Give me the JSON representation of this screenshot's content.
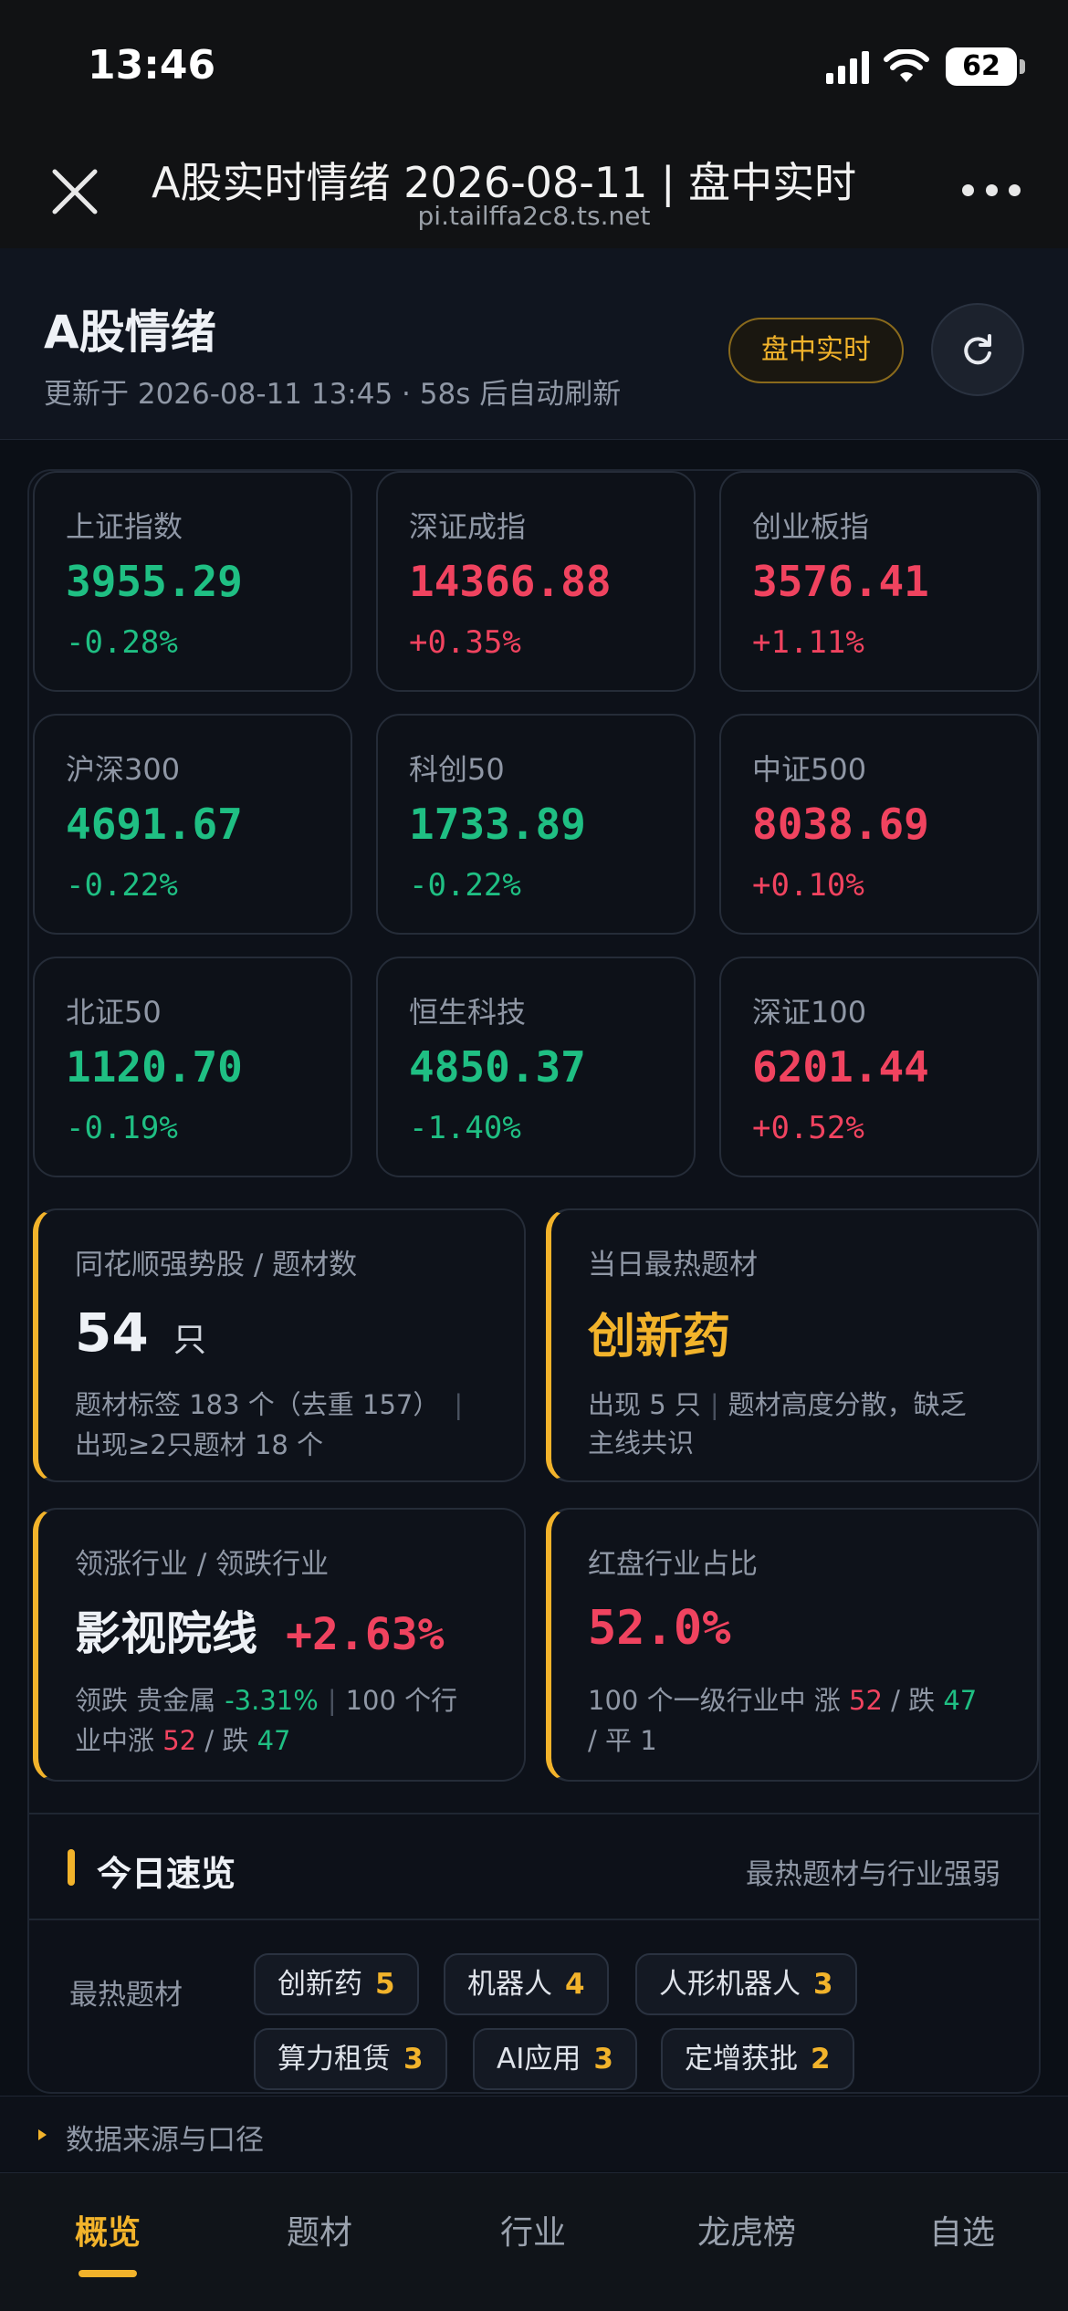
{
  "status_bar": {
    "time": "13:46",
    "battery": "62"
  },
  "browser": {
    "title": "A股实时情绪 2026-08-11 | 盘中实时",
    "url": "pi.tailffa2c8.ts.net"
  },
  "header": {
    "title": "A股情绪",
    "updated": "更新于 2026-08-11 13:45 · 58s 后自动刷新",
    "live_badge": "盘中实时"
  },
  "indices": [
    {
      "name": "上证指数",
      "value": "3955.29",
      "change": "-0.28%",
      "direction": "down"
    },
    {
      "name": "深证成指",
      "value": "14366.88",
      "change": "+0.35%",
      "direction": "up"
    },
    {
      "name": "创业板指",
      "value": "3576.41",
      "change": "+1.11%",
      "direction": "up"
    },
    {
      "name": "沪深300",
      "value": "4691.67",
      "change": "-0.22%",
      "direction": "down"
    },
    {
      "name": "科创50",
      "value": "1733.89",
      "change": "-0.22%",
      "direction": "down"
    },
    {
      "name": "中证500",
      "value": "8038.69",
      "change": "+0.10%",
      "direction": "up"
    },
    {
      "name": "北证50",
      "value": "1120.70",
      "change": "-0.19%",
      "direction": "down"
    },
    {
      "name": "恒生科技",
      "value": "4850.37",
      "change": "-1.40%",
      "direction": "down"
    },
    {
      "name": "深证100",
      "value": "6201.44",
      "change": "+0.52%",
      "direction": "up"
    }
  ],
  "cards": {
    "strong": {
      "label": "同花顺强势股 / 题材数",
      "count": "54",
      "unit": "只",
      "line1": "题材标签 183 个（去重 157）",
      "line2": "出现≥2只题材 18 个"
    },
    "hot_theme": {
      "label": "当日最热题材",
      "name": "创新药",
      "line1": "出现 5 只",
      "line1b": "题材高度分散，缺乏",
      "line2": "主线共识"
    },
    "lead": {
      "label": "领涨行业 / 领跌行业",
      "name": "影视院线",
      "change": "+2.63%",
      "l1a": "领跌 贵金属",
      "l1b": "-3.31%",
      "l1c": "100 个行",
      "l2a": "业中涨",
      "l2b": "52",
      "l2c": "/ 跌",
      "l2d": "47"
    },
    "red_ratio": {
      "label": "红盘行业占比",
      "value": "52.0%",
      "l1a": "100 个一级行业中 涨",
      "l1b": "52",
      "l1c": "/ 跌",
      "l1d": "47",
      "l2": "/ 平 1"
    }
  },
  "overview": {
    "title": "今日速览",
    "subtitle": "最热题材与行业强弱",
    "row_label": "最热题材",
    "tags": [
      {
        "name": "创新药",
        "count": "5"
      },
      {
        "name": "机器人",
        "count": "4"
      },
      {
        "name": "人形机器人",
        "count": "3"
      },
      {
        "name": "算力租赁",
        "count": "3"
      },
      {
        "name": "AI应用",
        "count": "3"
      },
      {
        "name": "定增获批",
        "count": "2"
      }
    ]
  },
  "footnote": "数据来源与口径",
  "tabs": [
    "概览",
    "题材",
    "行业",
    "龙虎榜",
    "自选"
  ],
  "colors": {
    "accent": "#f2b32b",
    "up": "#f0435f",
    "down": "#1fbf83"
  }
}
